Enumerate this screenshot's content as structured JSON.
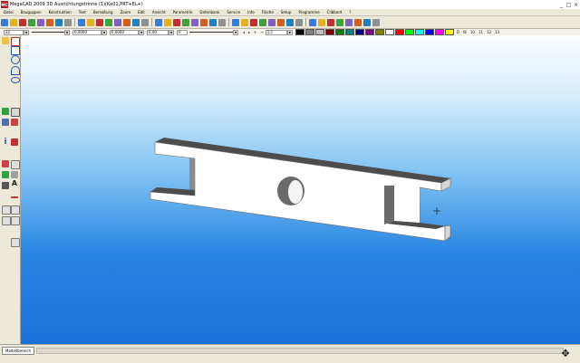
{
  "window": {
    "title": "MegaCAD 2009 3D  Ausrichtungstrinne (1)(Ka01,PRT+EL+)",
    "app_icon_label": "MC",
    "minimize_glyph": "_",
    "maximize_glyph": "□",
    "close_glyph": "×"
  },
  "menu": [
    "Datei",
    "Bauguppen",
    "Konstruktion",
    "Text",
    "Bemaßung",
    "Zoom",
    "Edit",
    "Ansicht",
    "Parametrik",
    "Datenbank",
    "Service",
    "Info",
    "Fläche",
    "Setup",
    "Programme",
    "Clibbord",
    "?"
  ],
  "toolbar1": {
    "colors": [
      "#3a7bd5",
      "#e8b020",
      "#c03030",
      "#40a040",
      "#8060c0",
      "#d06020",
      "#2080c0",
      "#909090"
    ]
  },
  "toolbar2": {
    "layer_value": "22",
    "line_value_1": "0,0000",
    "line_value_2": "0,0000",
    "grid_value": "0,00",
    "pen_value": "0",
    "scale_value": "1:1",
    "color_swatches": [
      "#000000",
      "#808080",
      "#c0c0c0",
      "#800000",
      "#008000",
      "#008080",
      "#000080",
      "#800080",
      "#808000",
      "#ffffff",
      "#ff0000",
      "#00ff00",
      "#00ffff",
      "#0000ff",
      "#ff00ff",
      "#ffff00"
    ],
    "right_labels": [
      "D",
      "W",
      "10",
      "11",
      "12",
      "13"
    ]
  },
  "left_toolbar": {
    "info_label": "i",
    "text_label": "A"
  },
  "bottom": {
    "tab_label": "Modellbereich",
    "nav_glyph": "✥"
  },
  "viewport": {
    "background_top": "#fbfdff",
    "background_bottom": "#1a70d9",
    "part_color": "#ffffff",
    "part_shadow": "#5a5a5a"
  }
}
